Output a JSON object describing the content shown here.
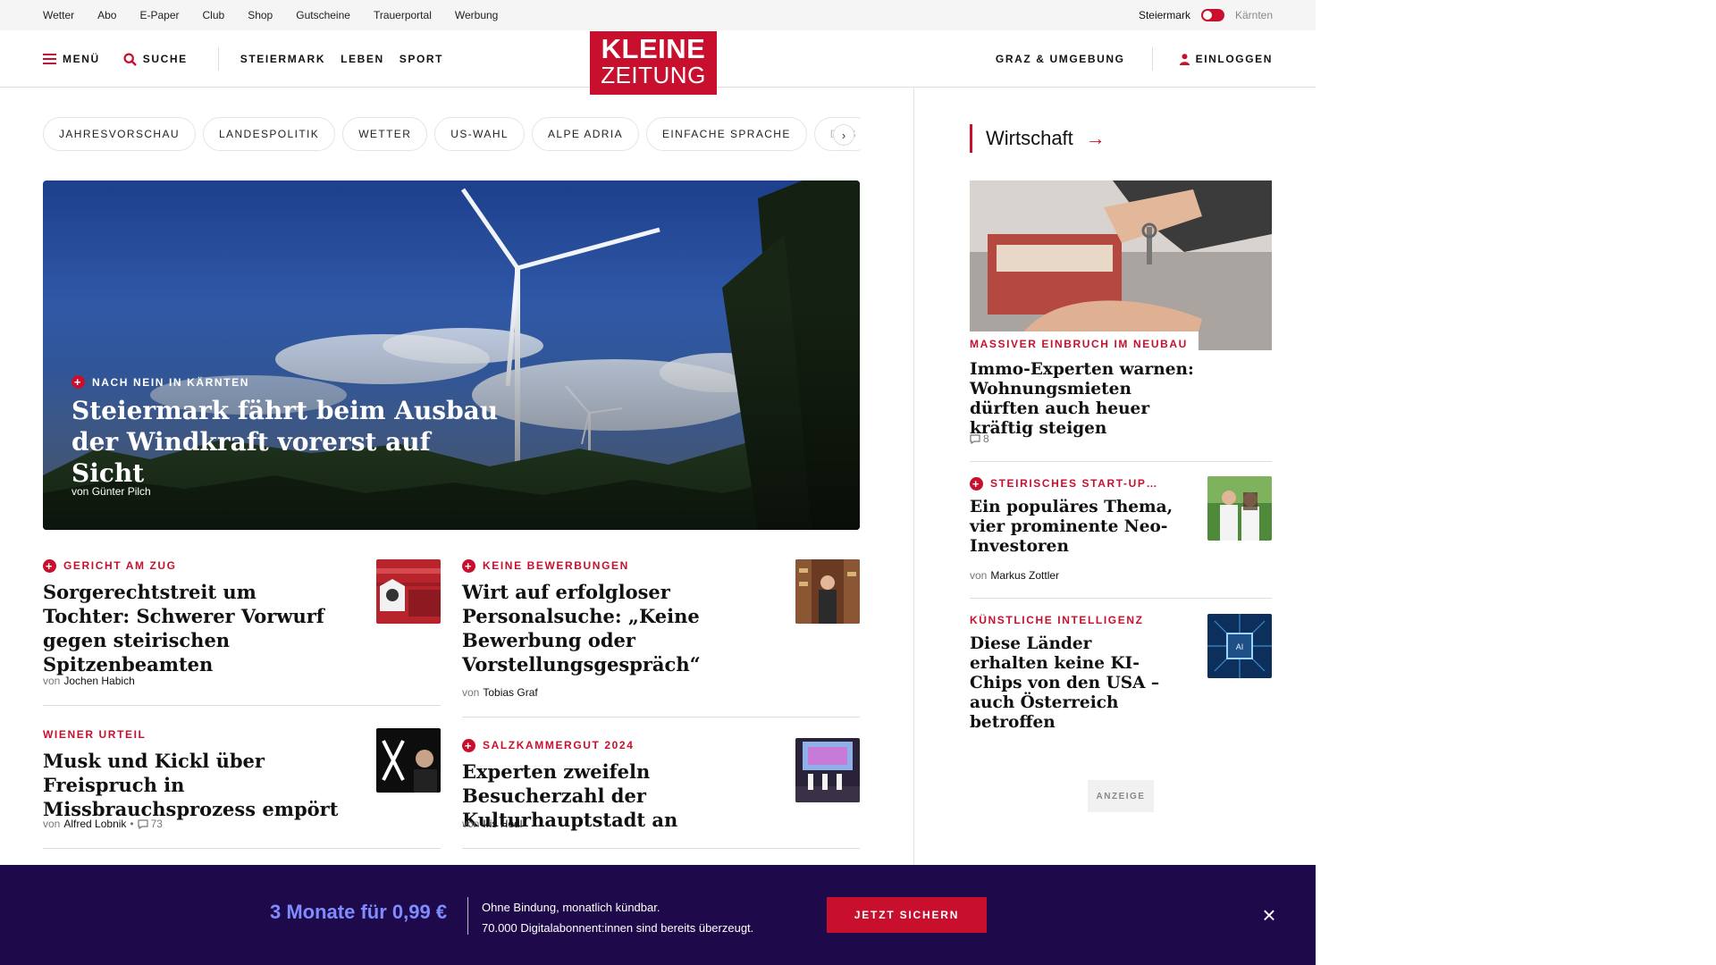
{
  "utility_nav": {
    "links": [
      "Wetter",
      "Abo",
      "E-Paper",
      "Club",
      "Shop",
      "Gutscheine",
      "Trauerportal",
      "Werbung"
    ],
    "region_active": "Steiermark",
    "region_inactive": "Kärnten"
  },
  "header": {
    "menu_label": "MENÜ",
    "search_label": "SUCHE",
    "nav": [
      "STEIERMARK",
      "LEBEN",
      "SPORT"
    ],
    "logo_line1": "KLEINE",
    "logo_line2": "ZEITUNG",
    "graz_label": "GRAZ & UMGEBUNG",
    "login_label": "EINLOGGEN"
  },
  "chips": [
    "JAHRESVORSCHAU",
    "LANDESPOLITIK",
    "WETTER",
    "US-WAHL",
    "ALPE ADRIA",
    "EINFACHE SPRACHE",
    "DOS"
  ],
  "chips_next_glyph": "›",
  "hero": {
    "kicker": "NACH NEIN IN KÄRNTEN",
    "headline": "Steiermark fährt beim Ausbau der Windkraft vorerst auf Sicht",
    "author_prefix": "von",
    "author": "Günter Pilch"
  },
  "articles": [
    {
      "kicker": "GERICHT AM ZUG",
      "premium": true,
      "title": "Sorgerechtstreit um Tochter: Schwerer Vorwurf gegen steirischen Spitzenbeamten",
      "author_prefix": "von",
      "author": "Jochen Habich"
    },
    {
      "kicker": "KEINE BEWERBUNGEN",
      "premium": true,
      "title": "Wirt auf erfolgloser Personalsuche: „Keine Bewerbung oder Vorstellungsgespräch“",
      "author_prefix": "von",
      "author": "Tobias Graf"
    },
    {
      "kicker": "WIENER URTEIL",
      "premium": false,
      "title": "Musk und Kickl über Freispruch in Missbrauchsprozess empört",
      "author_prefix": "von",
      "author": "Alfred Lobnik",
      "comments": "73"
    },
    {
      "kicker": "SALZKAMMERGUT 2024",
      "premium": true,
      "title": "Experten zweifeln Besucherzahl der Kulturhauptstadt an",
      "author_prefix": "von",
      "author": "Iris Hödl"
    }
  ],
  "sidebar": {
    "section_title": "Wirtschaft",
    "section_arrow": "→",
    "items": [
      {
        "kicker": "MASSIVER EINBRUCH IM NEUBAU",
        "premium": false,
        "title": "Immo-Experten warnen: Wohnungsmieten dürften auch heuer kräftig steigen",
        "comments": "8"
      },
      {
        "kicker": "STEIRISCHES START-UP…",
        "premium": true,
        "title": "Ein populäres Thema, vier prominente Neo-Investoren",
        "author_prefix": "von",
        "author": "Markus Zottler"
      },
      {
        "kicker": "KÜNSTLICHE INTELLIGENZ",
        "premium": false,
        "title": "Diese Länder erhalten keine KI-Chips von den USA – auch Österreich betroffen"
      }
    ],
    "ad_label": "ANZEIGE"
  },
  "promo": {
    "price": "3 Monate für 0,99 €",
    "line1": "Ohne Bindung, monatlich kündbar.",
    "line2": "70.000 Digitalabonnent:innen sind bereits überzeugt.",
    "cta": "JETZT SICHERN",
    "close_glyph": "×"
  },
  "colors": {
    "brand_red": "#c8102e",
    "promo_bg": "#1e0a4a",
    "promo_price": "#7f8cff"
  },
  "icons": [
    "hamburger-icon",
    "search-icon",
    "user-icon",
    "plus-premium-icon",
    "comment-icon",
    "arrow-right-icon",
    "chevron-right-icon",
    "close-icon"
  ]
}
